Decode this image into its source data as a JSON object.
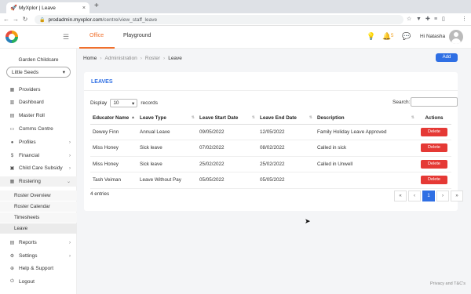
{
  "browser": {
    "tab_title": "MyXplor | Leave",
    "tab_close": "×",
    "new_tab": "+",
    "url_host": "prodadmin.myxplor.com",
    "url_path": "/centre/view_staff_leave",
    "profile_initial": "N"
  },
  "header": {
    "tabs": [
      "Office",
      "Playground"
    ],
    "active_tab": "Office",
    "notification_count": "5",
    "greeting": "Hi Natasha"
  },
  "sidebar": {
    "centre_name": "Garden Childcare",
    "centre_select": "Little Seeds",
    "items": [
      {
        "label": "Providers",
        "icon": "building-icon"
      },
      {
        "label": "Dashboard",
        "icon": "dashboard-icon"
      },
      {
        "label": "Master Roll",
        "icon": "list-icon"
      },
      {
        "label": "Comms Centre",
        "icon": "chat-icon"
      },
      {
        "label": "Profiles",
        "icon": "users-icon"
      },
      {
        "label": "Financial",
        "icon": "dollar-icon"
      },
      {
        "label": "Child Care Subsidy",
        "icon": "ccs-icon"
      },
      {
        "label": "Rostering",
        "icon": "calendar-icon"
      }
    ],
    "rostering_sub": [
      "Roster Overview",
      "Roster Calendar",
      "Timesheets",
      "Leave"
    ],
    "bottom_items": [
      {
        "label": "Reports",
        "icon": "report-icon"
      },
      {
        "label": "Settings",
        "icon": "gear-icon"
      },
      {
        "label": "Help & Support",
        "icon": "help-icon"
      },
      {
        "label": "Logout",
        "icon": "logout-icon"
      }
    ]
  },
  "breadcrumb": [
    "Home",
    "Administration",
    "Roster",
    "Leave"
  ],
  "add_label": "Add",
  "card": {
    "title": "LEAVES",
    "display_label": "Display",
    "page_size": "10",
    "records_label": "records",
    "search_label": "Search:",
    "search_value": "",
    "columns": [
      "Educator Name",
      "Leave Type",
      "Leave Start Date",
      "Leave End Date",
      "Description",
      "Actions"
    ],
    "rows": [
      [
        "Dewey Finn",
        "Annual Leave",
        "09/05/2022",
        "12/05/2022",
        "Family Holiday Leave Approved"
      ],
      [
        "Miss Honey",
        "Sick leave",
        "07/02/2022",
        "08/02/2022",
        "Called in sick"
      ],
      [
        "Miss Honey",
        "Sick leave",
        "25/02/2022",
        "25/02/2022",
        "Called in Unwell"
      ],
      [
        "Tash Veiman",
        "Leave Without Pay",
        "05/05/2022",
        "05/05/2022",
        ""
      ]
    ],
    "delete_label": "Delete",
    "entries_text": "4 entries",
    "pager": [
      "«",
      "‹",
      "1",
      "›",
      "»"
    ]
  },
  "footer": {
    "privacy": "Privacy and T&C's"
  },
  "colors": {
    "accent": "#2f6fe4",
    "orange": "#f0702c",
    "danger": "#e53935"
  }
}
